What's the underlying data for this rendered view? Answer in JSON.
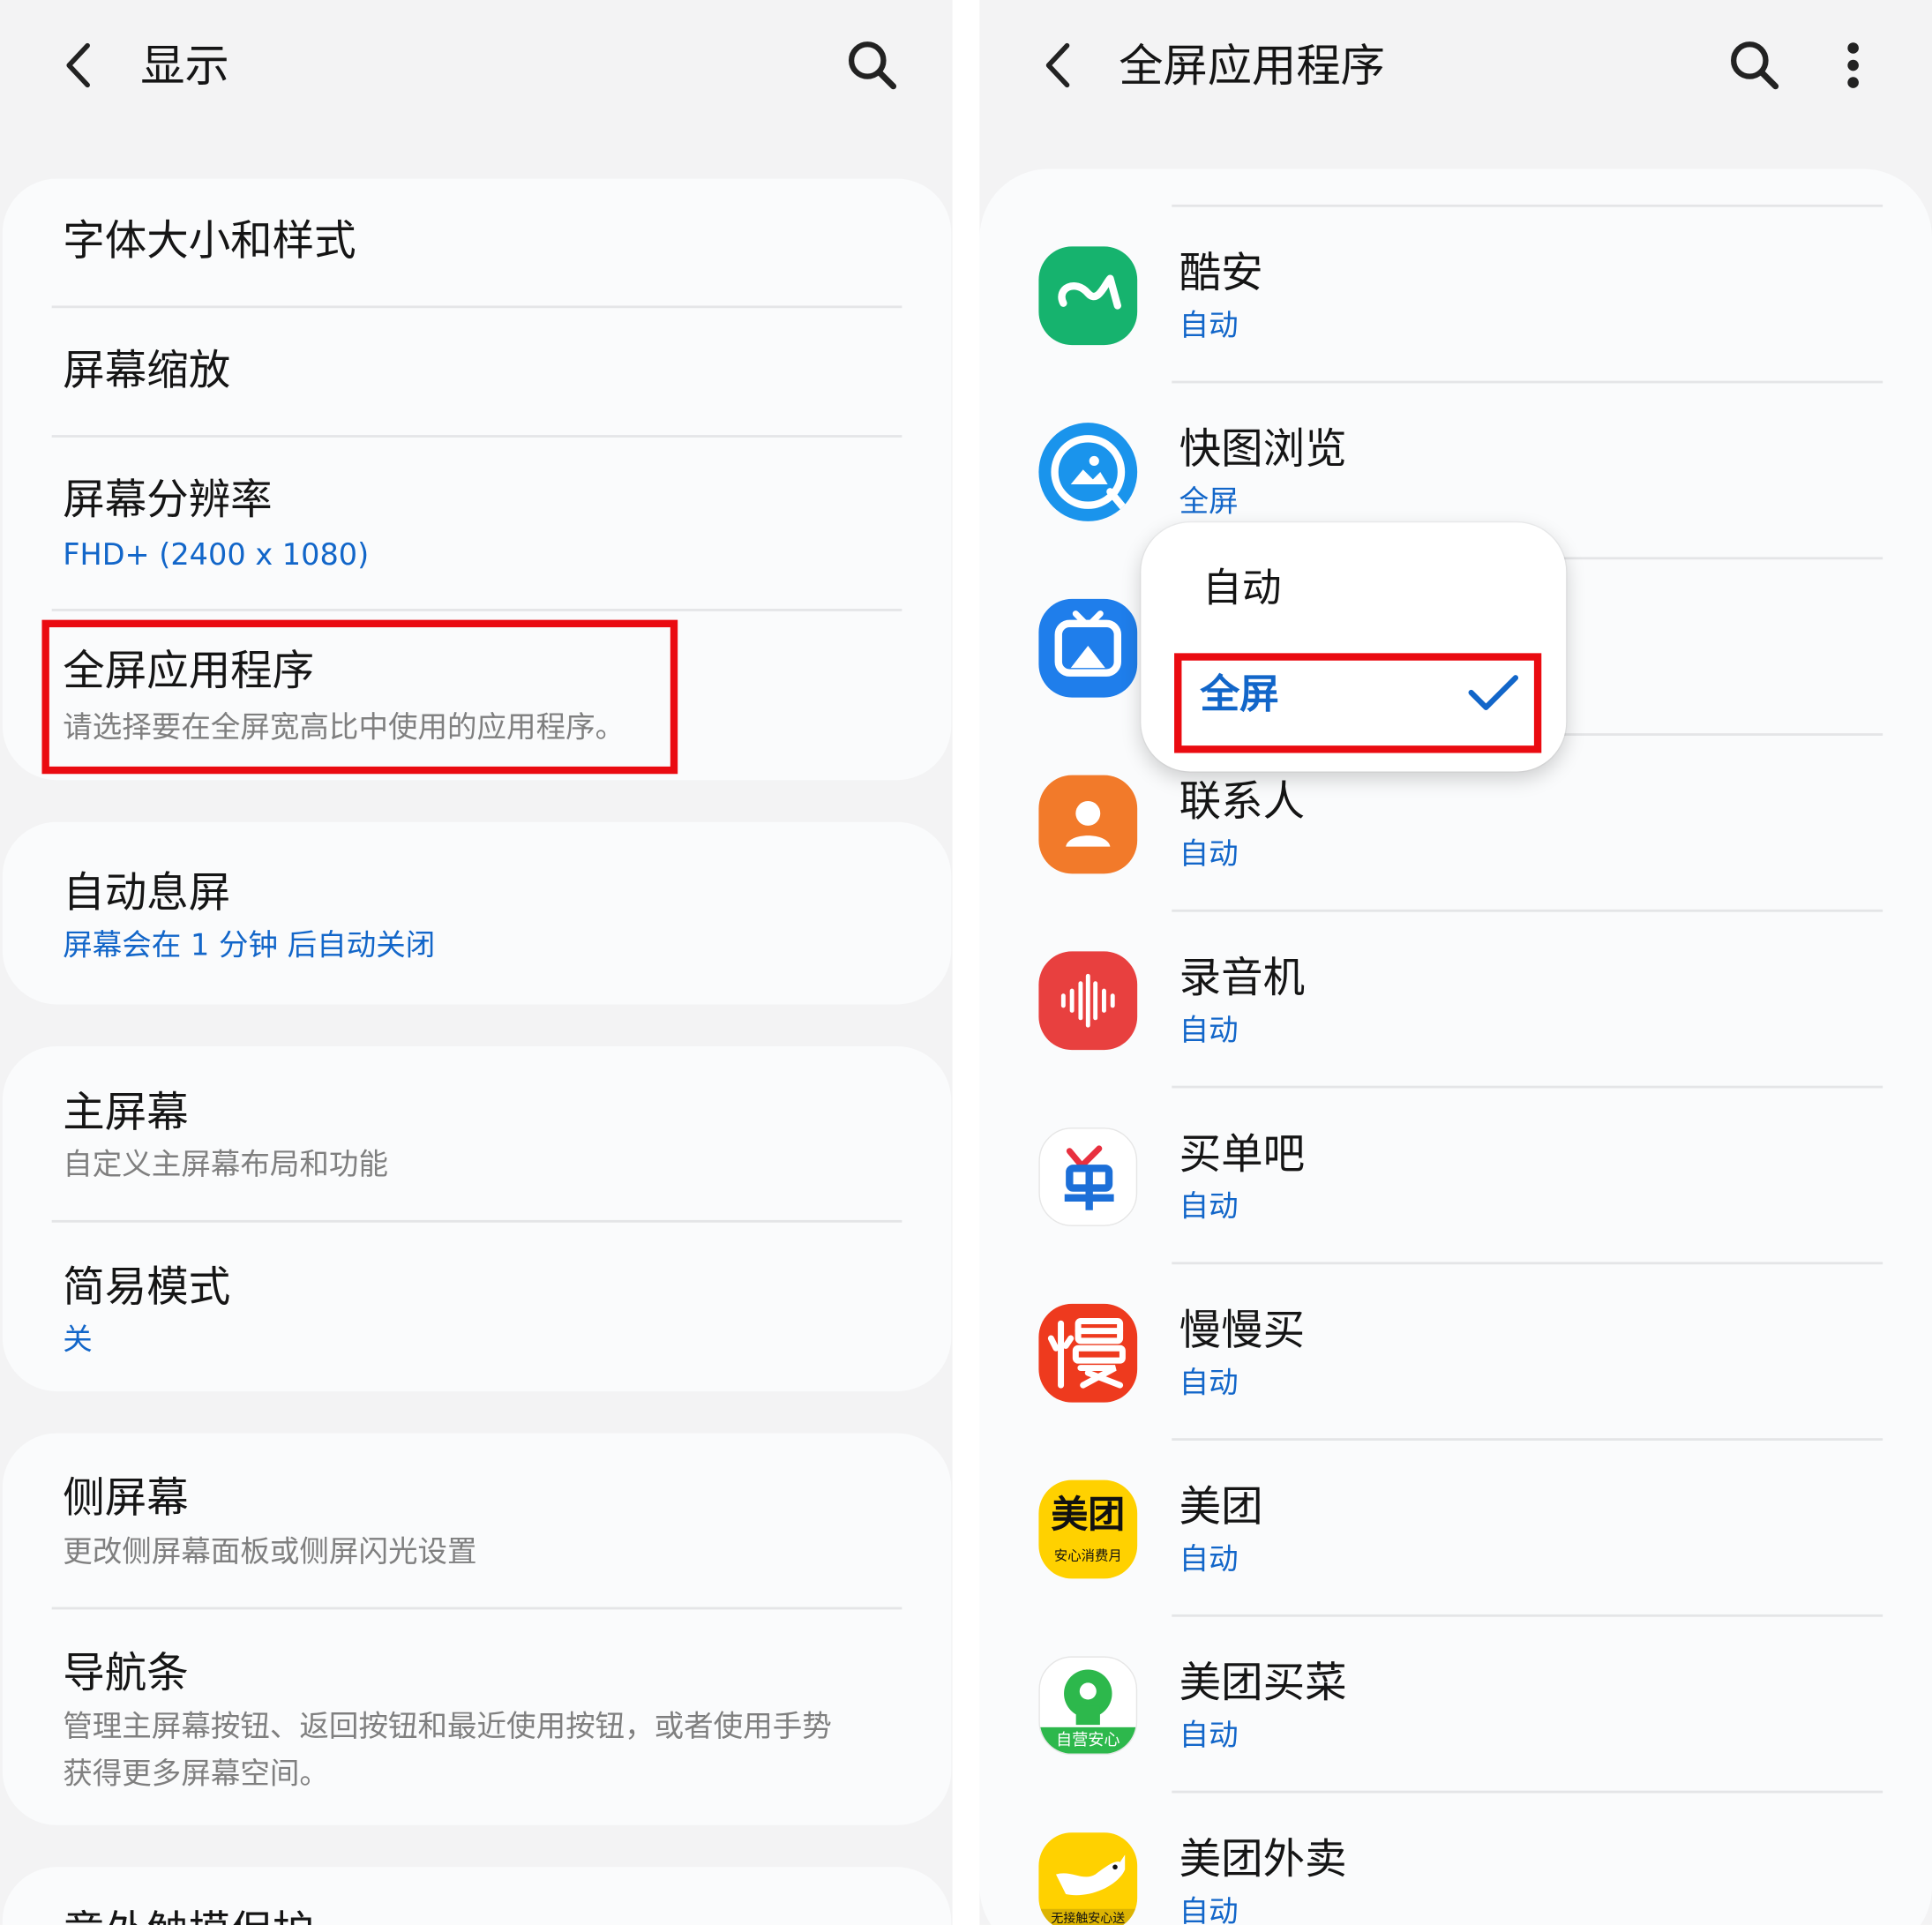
{
  "left": {
    "header": {
      "title": "显示",
      "back_icon": "chevron-left-icon",
      "search_icon": "search-icon"
    },
    "card1": [
      {
        "title": "字体大小和样式"
      },
      {
        "title": "屏幕缩放"
      },
      {
        "title": "屏幕分辨率",
        "subtitle": "FHD+ (2400 x 1080)"
      },
      {
        "title": "全屏应用程序",
        "subtitle": "请选择要在全屏宽高比中使用的应用程序。"
      }
    ],
    "card2": [
      {
        "title": "自动息屏",
        "subtitle": "屏幕会在 1 分钟 后自动关闭"
      }
    ],
    "card3": [
      {
        "title": "主屏幕",
        "subtitle": "自定义主屏幕布局和功能"
      },
      {
        "title": "简易模式",
        "subtitle": "关"
      }
    ],
    "card4": [
      {
        "title": "侧屏幕",
        "subtitle": "更改侧屏幕面板或侧屏闪光设置"
      },
      {
        "title": "导航条",
        "subtitle_line1": "管理主屏幕按钮、返回按钮和最近使用按钮，或者使用手势",
        "subtitle_line2": "获得更多屏幕空间。"
      }
    ],
    "card5": [
      {
        "title": "意外触摸保护"
      }
    ]
  },
  "right": {
    "header": {
      "title": "全屏应用程序",
      "back_icon": "chevron-left-icon",
      "search_icon": "search-icon",
      "more_icon": "more-vertical-icon"
    },
    "apps": [
      {
        "name": "酷安",
        "mode": "自动",
        "icon": "coolapk-app-icon",
        "color": "#16b36e"
      },
      {
        "name": "快图浏览",
        "mode": "全屏",
        "icon": "quickpic-app-icon",
        "color": "#1a94ec"
      },
      {
        "name": "",
        "mode": "",
        "icon": "video-app-icon",
        "color": "#1f7eeb"
      },
      {
        "name": "联系人",
        "mode": "自动",
        "icon": "contacts-app-icon",
        "color": "#f27a2a"
      },
      {
        "name": "录音机",
        "mode": "自动",
        "icon": "voice-recorder-app-icon",
        "color": "#e8403f"
      },
      {
        "name": "买单吧",
        "mode": "自动",
        "icon": "maidanba-app-icon",
        "color": "#1c6fd8"
      },
      {
        "name": "慢慢买",
        "mode": "自动",
        "icon": "manmanmai-app-icon",
        "color": "#ee3a1e"
      },
      {
        "name": "美团",
        "mode": "自动",
        "icon": "meituan-app-icon",
        "color": "#ffd100",
        "icon_text": "美团",
        "icon_subtext": "安心消费月"
      },
      {
        "name": "美团买菜",
        "mode": "自动",
        "icon": "meituan-maicai-app-icon",
        "color": "#2db84c",
        "icon_subtext": "自营安心"
      },
      {
        "name": "美团外卖",
        "mode": "自动",
        "icon": "meituan-waimai-app-icon",
        "color": "#ffd100",
        "icon_subtext": "无接触安心送"
      }
    ],
    "popup": {
      "options": [
        "自动",
        "全屏"
      ],
      "selected": "全屏",
      "check_icon": "checkmark-icon"
    }
  },
  "colors": {
    "accent": "#1266c9",
    "highlight": "#ea0b11",
    "background": "#f3f3f4",
    "card": "#fafbfc"
  }
}
